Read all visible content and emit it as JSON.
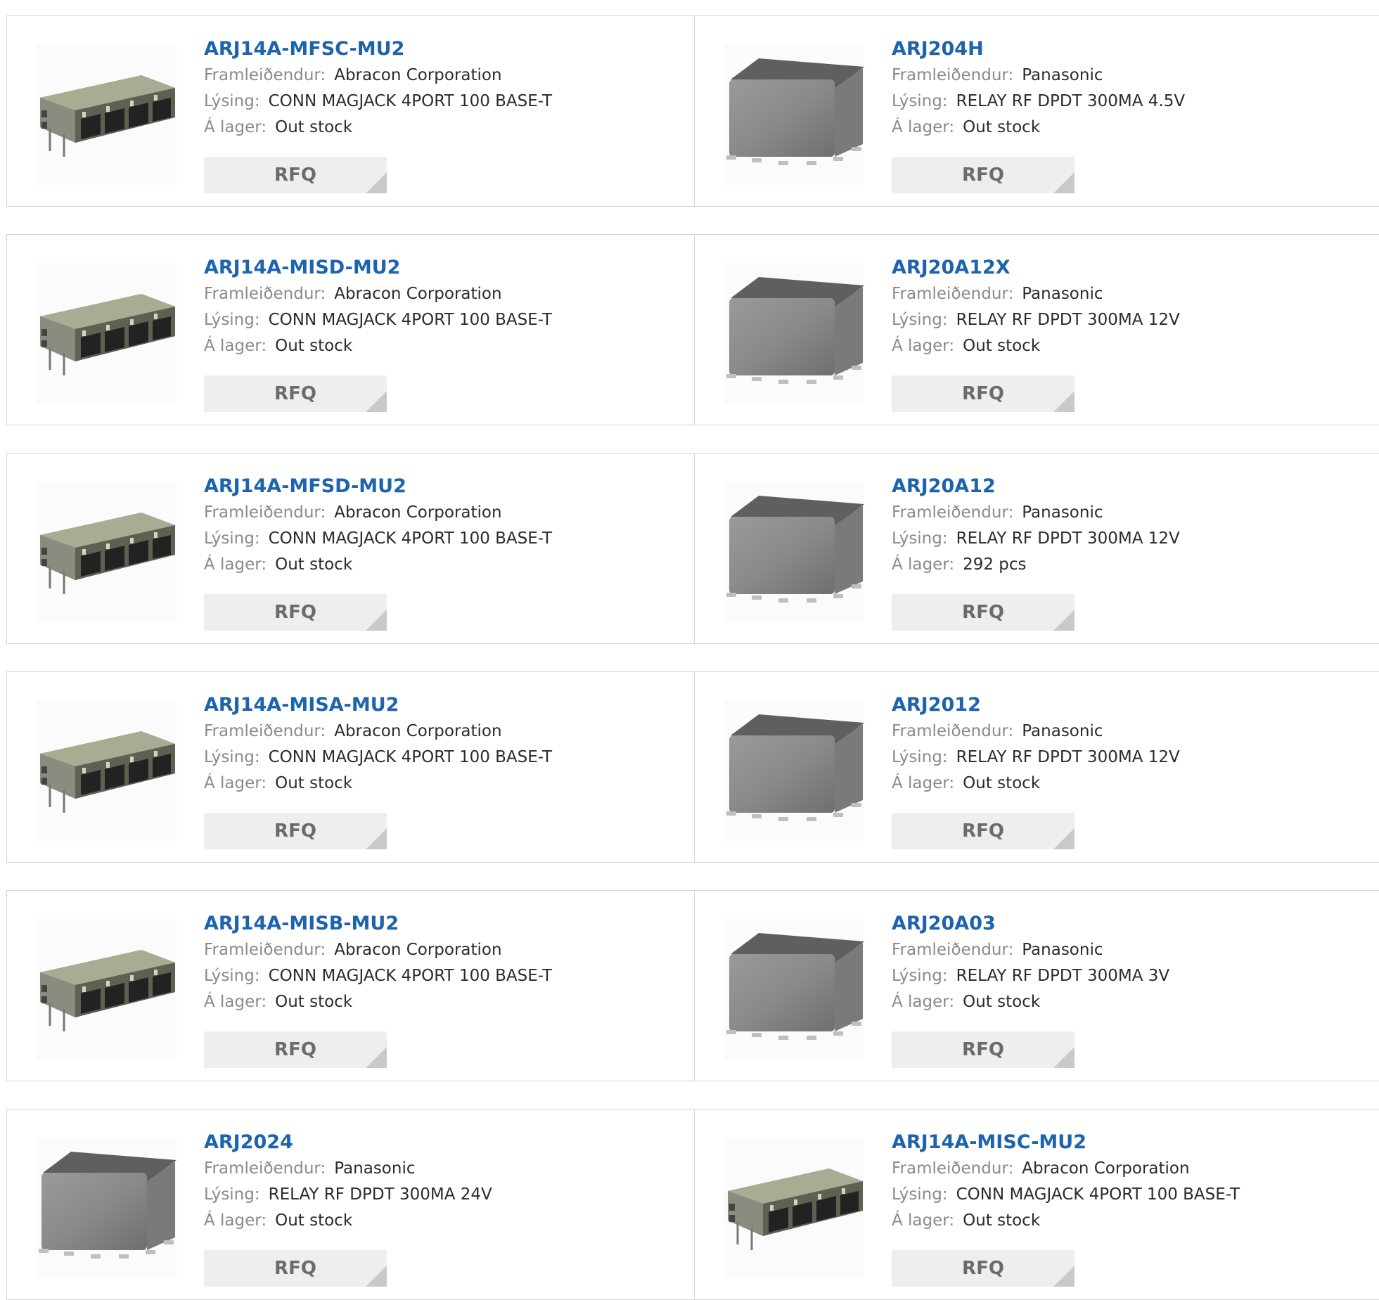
{
  "labels": {
    "manufacturer": "Framleiðendur:",
    "description": "Lýsing:",
    "stock": "Á lager:",
    "rfq": "RFQ"
  },
  "rows": [
    {
      "left": {
        "part": "ARJ14A-MFSC-MU2",
        "manufacturer": "Abracon Corporation",
        "description": "CONN MAGJACK 4PORT 100 BASE-T",
        "stock": "Out stock",
        "image": "rj45-connector-image"
      },
      "right": {
        "part": "ARJ204H",
        "manufacturer": "Panasonic",
        "description": "RELAY RF DPDT 300MA 4.5V",
        "stock": "Out stock",
        "image": "relay-image"
      }
    },
    {
      "left": {
        "part": "ARJ14A-MISD-MU2",
        "manufacturer": "Abracon Corporation",
        "description": "CONN MAGJACK 4PORT 100 BASE-T",
        "stock": "Out stock",
        "image": "rj45-connector-image"
      },
      "right": {
        "part": "ARJ20A12X",
        "manufacturer": "Panasonic",
        "description": "RELAY RF DPDT 300MA 12V",
        "stock": "Out stock",
        "image": "relay-image"
      }
    },
    {
      "left": {
        "part": "ARJ14A-MFSD-MU2",
        "manufacturer": "Abracon Corporation",
        "description": "CONN MAGJACK 4PORT 100 BASE-T",
        "stock": "Out stock",
        "image": "rj45-connector-image"
      },
      "right": {
        "part": "ARJ20A12",
        "manufacturer": "Panasonic",
        "description": "RELAY RF DPDT 300MA 12V",
        "stock": "292 pcs",
        "image": "relay-image"
      }
    },
    {
      "left": {
        "part": "ARJ14A-MISA-MU2",
        "manufacturer": "Abracon Corporation",
        "description": "CONN MAGJACK 4PORT 100 BASE-T",
        "stock": "Out stock",
        "image": "rj45-connector-image"
      },
      "right": {
        "part": "ARJ2012",
        "manufacturer": "Panasonic",
        "description": "RELAY RF DPDT 300MA 12V",
        "stock": "Out stock",
        "image": "relay-image"
      }
    },
    {
      "left": {
        "part": "ARJ14A-MISB-MU2",
        "manufacturer": "Abracon Corporation",
        "description": "CONN MAGJACK 4PORT 100 BASE-T",
        "stock": "Out stock",
        "image": "rj45-connector-image"
      },
      "right": {
        "part": "ARJ20A03",
        "manufacturer": "Panasonic",
        "description": "RELAY RF DPDT 300MA 3V",
        "stock": "Out stock",
        "image": "relay-image"
      }
    },
    {
      "left": {
        "part": "ARJ2024",
        "manufacturer": "Panasonic",
        "description": "RELAY RF DPDT 300MA 24V",
        "stock": "Out stock",
        "image": "relay-image"
      },
      "right": {
        "part": "ARJ14A-MISC-MU2",
        "manufacturer": "Abracon Corporation",
        "description": "CONN MAGJACK 4PORT 100 BASE-T",
        "stock": "Out stock",
        "image": "rj45-connector-image"
      }
    }
  ]
}
